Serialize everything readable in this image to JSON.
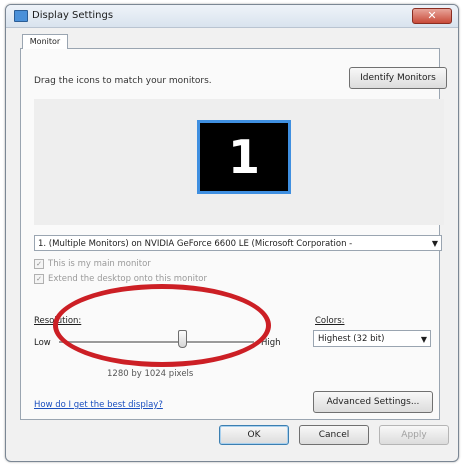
{
  "window": {
    "title": "Display Settings",
    "close_symbol": "✕"
  },
  "tab": {
    "label": "Monitor"
  },
  "instruction": "Drag the icons to match your monitors.",
  "identify_button": "Identify Monitors",
  "monitor_number": "1",
  "display_select": "1. (Multiple Monitors) on NVIDIA GeForce 6600 LE (Microsoft Corporation -",
  "checks": {
    "main_monitor": "This is my main monitor",
    "extend_desktop": "Extend the desktop onto this monitor"
  },
  "resolution": {
    "label": "Resolution:",
    "low": "Low",
    "high": "High",
    "value_text": "1280 by 1024 pixels"
  },
  "colors": {
    "label": "Colors:",
    "value": "Highest (32 bit)"
  },
  "help_link": "How do I get the best display?",
  "advanced_button": "Advanced Settings...",
  "buttons": {
    "ok": "OK",
    "cancel": "Cancel",
    "apply": "Apply"
  },
  "accent_colors": {
    "highlight_ellipse": "#cc1f25",
    "monitor_border": "#3f8fe0",
    "link": "#1a4fbf"
  }
}
